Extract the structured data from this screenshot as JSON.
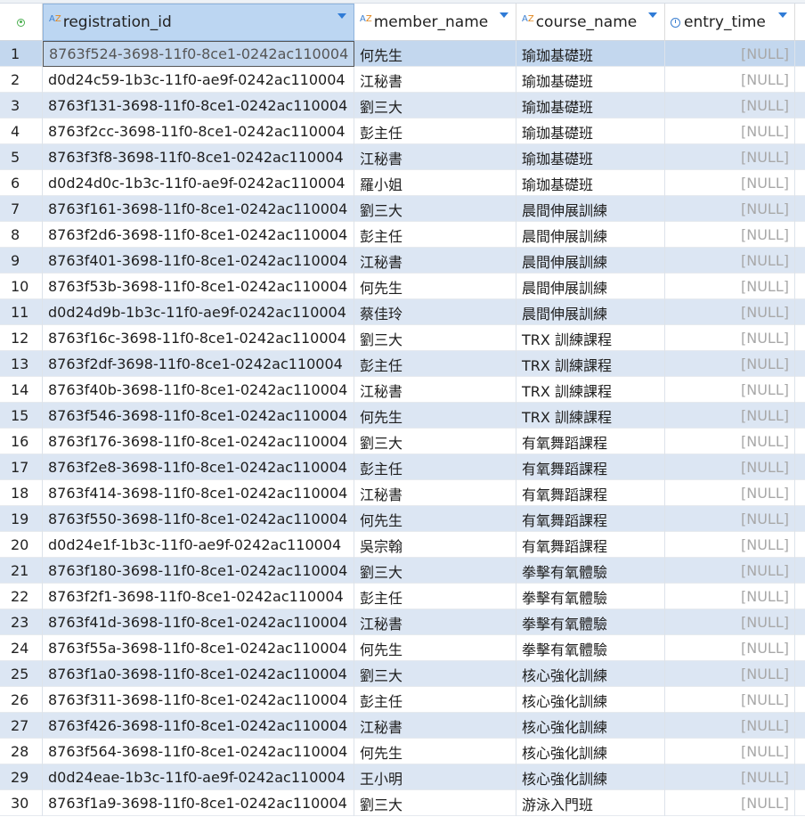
{
  "columns": [
    {
      "label": "registration_id",
      "icon": "text-type-icon",
      "selected": true
    },
    {
      "label": "member_name",
      "icon": "text-type-icon",
      "selected": false
    },
    {
      "label": "course_name",
      "icon": "text-type-icon",
      "selected": false
    },
    {
      "label": "entry_time",
      "icon": "clock-icon",
      "selected": false
    }
  ],
  "type_icon_text": {
    "a": "A",
    "z": "Z"
  },
  "selected_row": 1,
  "rows": [
    {
      "n": "1",
      "registration_id": "8763f524-3698-11f0-8ce1-0242ac110004",
      "member_name": "何先生",
      "course_name": "瑜珈基礎班",
      "entry_time": "[NULL]"
    },
    {
      "n": "2",
      "registration_id": "d0d24c59-1b3c-11f0-ae9f-0242ac110004",
      "member_name": "江秘書",
      "course_name": "瑜珈基礎班",
      "entry_time": "[NULL]"
    },
    {
      "n": "3",
      "registration_id": "8763f131-3698-11f0-8ce1-0242ac110004",
      "member_name": "劉三大",
      "course_name": "瑜珈基礎班",
      "entry_time": "[NULL]"
    },
    {
      "n": "4",
      "registration_id": "8763f2cc-3698-11f0-8ce1-0242ac110004",
      "member_name": "彭主任",
      "course_name": "瑜珈基礎班",
      "entry_time": "[NULL]"
    },
    {
      "n": "5",
      "registration_id": "8763f3f8-3698-11f0-8ce1-0242ac110004",
      "member_name": "江秘書",
      "course_name": "瑜珈基礎班",
      "entry_time": "[NULL]"
    },
    {
      "n": "6",
      "registration_id": "d0d24d0c-1b3c-11f0-ae9f-0242ac110004",
      "member_name": "羅小姐",
      "course_name": "瑜珈基礎班",
      "entry_time": "[NULL]"
    },
    {
      "n": "7",
      "registration_id": "8763f161-3698-11f0-8ce1-0242ac110004",
      "member_name": "劉三大",
      "course_name": "晨間伸展訓練",
      "entry_time": "[NULL]"
    },
    {
      "n": "8",
      "registration_id": "8763f2d6-3698-11f0-8ce1-0242ac110004",
      "member_name": "彭主任",
      "course_name": "晨間伸展訓練",
      "entry_time": "[NULL]"
    },
    {
      "n": "9",
      "registration_id": "8763f401-3698-11f0-8ce1-0242ac110004",
      "member_name": "江秘書",
      "course_name": "晨間伸展訓練",
      "entry_time": "[NULL]"
    },
    {
      "n": "10",
      "registration_id": "8763f53b-3698-11f0-8ce1-0242ac110004",
      "member_name": "何先生",
      "course_name": "晨間伸展訓練",
      "entry_time": "[NULL]"
    },
    {
      "n": "11",
      "registration_id": "d0d24d9b-1b3c-11f0-ae9f-0242ac110004",
      "member_name": "蔡佳玲",
      "course_name": "晨間伸展訓練",
      "entry_time": "[NULL]"
    },
    {
      "n": "12",
      "registration_id": "8763f16c-3698-11f0-8ce1-0242ac110004",
      "member_name": "劉三大",
      "course_name": "TRX 訓練課程",
      "entry_time": "[NULL]"
    },
    {
      "n": "13",
      "registration_id": "8763f2df-3698-11f0-8ce1-0242ac110004",
      "member_name": "彭主任",
      "course_name": "TRX 訓練課程",
      "entry_time": "[NULL]"
    },
    {
      "n": "14",
      "registration_id": "8763f40b-3698-11f0-8ce1-0242ac110004",
      "member_name": "江秘書",
      "course_name": "TRX 訓練課程",
      "entry_time": "[NULL]"
    },
    {
      "n": "15",
      "registration_id": "8763f546-3698-11f0-8ce1-0242ac110004",
      "member_name": "何先生",
      "course_name": "TRX 訓練課程",
      "entry_time": "[NULL]"
    },
    {
      "n": "16",
      "registration_id": "8763f176-3698-11f0-8ce1-0242ac110004",
      "member_name": "劉三大",
      "course_name": "有氧舞蹈課程",
      "entry_time": "[NULL]"
    },
    {
      "n": "17",
      "registration_id": "8763f2e8-3698-11f0-8ce1-0242ac110004",
      "member_name": "彭主任",
      "course_name": "有氧舞蹈課程",
      "entry_time": "[NULL]"
    },
    {
      "n": "18",
      "registration_id": "8763f414-3698-11f0-8ce1-0242ac110004",
      "member_name": "江秘書",
      "course_name": "有氧舞蹈課程",
      "entry_time": "[NULL]"
    },
    {
      "n": "19",
      "registration_id": "8763f550-3698-11f0-8ce1-0242ac110004",
      "member_name": "何先生",
      "course_name": "有氧舞蹈課程",
      "entry_time": "[NULL]"
    },
    {
      "n": "20",
      "registration_id": "d0d24e1f-1b3c-11f0-ae9f-0242ac110004",
      "member_name": "吳宗翰",
      "course_name": "有氧舞蹈課程",
      "entry_time": "[NULL]"
    },
    {
      "n": "21",
      "registration_id": "8763f180-3698-11f0-8ce1-0242ac110004",
      "member_name": "劉三大",
      "course_name": "拳擊有氧體驗",
      "entry_time": "[NULL]"
    },
    {
      "n": "22",
      "registration_id": "8763f2f1-3698-11f0-8ce1-0242ac110004",
      "member_name": "彭主任",
      "course_name": "拳擊有氧體驗",
      "entry_time": "[NULL]"
    },
    {
      "n": "23",
      "registration_id": "8763f41d-3698-11f0-8ce1-0242ac110004",
      "member_name": "江秘書",
      "course_name": "拳擊有氧體驗",
      "entry_time": "[NULL]"
    },
    {
      "n": "24",
      "registration_id": "8763f55a-3698-11f0-8ce1-0242ac110004",
      "member_name": "何先生",
      "course_name": "拳擊有氧體驗",
      "entry_time": "[NULL]"
    },
    {
      "n": "25",
      "registration_id": "8763f1a0-3698-11f0-8ce1-0242ac110004",
      "member_name": "劉三大",
      "course_name": "核心強化訓練",
      "entry_time": "[NULL]"
    },
    {
      "n": "26",
      "registration_id": "8763f311-3698-11f0-8ce1-0242ac110004",
      "member_name": "彭主任",
      "course_name": "核心強化訓練",
      "entry_time": "[NULL]"
    },
    {
      "n": "27",
      "registration_id": "8763f426-3698-11f0-8ce1-0242ac110004",
      "member_name": "江秘書",
      "course_name": "核心強化訓練",
      "entry_time": "[NULL]"
    },
    {
      "n": "28",
      "registration_id": "8763f564-3698-11f0-8ce1-0242ac110004",
      "member_name": "何先生",
      "course_name": "核心強化訓練",
      "entry_time": "[NULL]"
    },
    {
      "n": "29",
      "registration_id": "d0d24eae-1b3c-11f0-ae9f-0242ac110004",
      "member_name": "王小明",
      "course_name": "核心強化訓練",
      "entry_time": "[NULL]"
    },
    {
      "n": "30",
      "registration_id": "8763f1a9-3698-11f0-8ce1-0242ac110004",
      "member_name": "劉三大",
      "course_name": "游泳入門班",
      "entry_time": "[NULL]"
    }
  ]
}
